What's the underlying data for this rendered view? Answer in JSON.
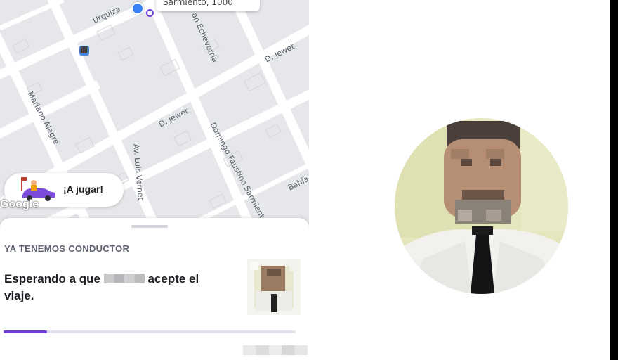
{
  "map": {
    "address_box_text": "Sarmiento, 1000",
    "streets": [
      "Urquiza",
      "an Echeverría",
      "D. Jewet",
      "Mariano Alegre",
      "D. Jewet",
      "Domingo Faustino Sarmiento",
      "Av. Luis Vernet",
      "Bahía"
    ],
    "attribution": "Google",
    "bus_stop_icon": "bus-stop-icon",
    "colors": {
      "map_bg": "#e6e7ea",
      "road": "#ffffff",
      "pin": "#3b82f6",
      "accent": "#6c3fce"
    }
  },
  "promo": {
    "label": "¡A jugar!",
    "icon": "car-racing-icon"
  },
  "sheet": {
    "kicker": "YA TENEMOS CONDUCTOR",
    "message_before": "Esperando a que",
    "message_after": "acepte el viaje.",
    "progress": 0.15
  },
  "portrait": {
    "icon": "driver-portrait-photo"
  }
}
